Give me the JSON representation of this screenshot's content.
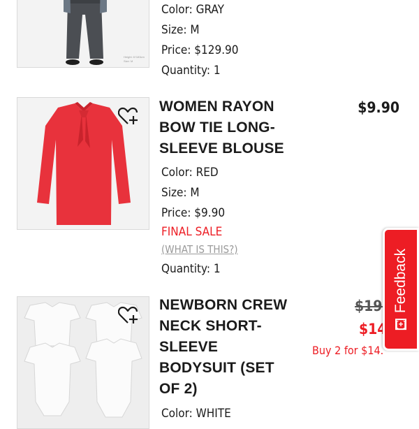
{
  "items": [
    {
      "color": "Color: GRAY",
      "size": "Size: M",
      "price": "Price: $129.90",
      "quantity": "Quantity: 1",
      "model_height": "Height: 6'/183cm",
      "model_size": "Size: M"
    },
    {
      "title": "WOMEN RAYON BOW TIE LONG-SLEEVE BLOUSE",
      "price_right": "$9.90",
      "color": "Color: RED",
      "size": "Size: M",
      "price": "Price: $9.90",
      "final_sale": "FINAL SALE",
      "what_is_this": "(WHAT IS THIS?)",
      "quantity": "Quantity: 1"
    },
    {
      "title": "NEWBORN CREW NECK SHORT-SLEEVE BODYSUIT (SET OF 2)",
      "original_price": "$19.",
      "sale_price": "$14",
      "promo": "Buy 2 for $14.",
      "color": "Color: WHITE"
    }
  ],
  "feedback": {
    "label": "Feedback",
    "icon": "[+]"
  },
  "colors": {
    "accent_red": "#ed1d24",
    "blouse": "#e8323c",
    "pants": "#4b4e53"
  },
  "icons": {
    "wishlist": "heart-plus-icon",
    "feedback": "expand-box-icon"
  }
}
